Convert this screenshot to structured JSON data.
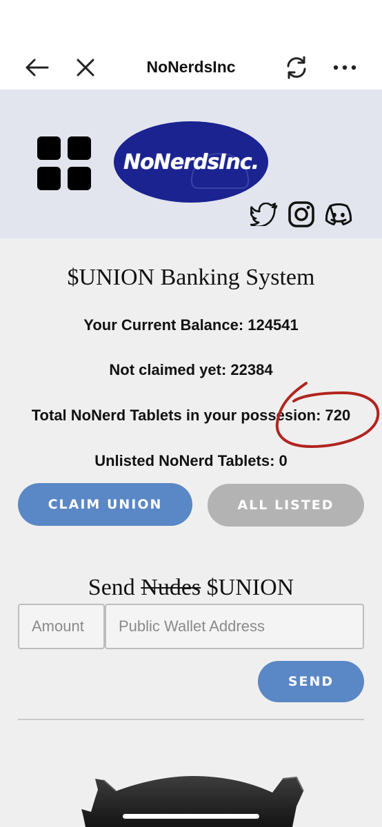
{
  "browser_bar": {
    "title": "NoNerdsInc",
    "icons": [
      "back-arrow-icon",
      "close-icon",
      "refresh-icon",
      "more-icon"
    ]
  },
  "header": {
    "logo_text": "NoNerdsInc.",
    "social_icons": [
      "twitter-icon",
      "instagram-icon",
      "discord-icon"
    ],
    "banner_color": "#e2e5ee",
    "logo_color": "#1a2390"
  },
  "banking": {
    "title": "$UNION Banking System",
    "current_balance": "Your Current Balance: 124541",
    "not_claimed": "Not claimed yet: 22384",
    "total_tablets": "Total NoNerd Tablets in your possesion: 720",
    "unlisted_tablets": "Unlisted NoNerd Tablets: 0",
    "claim_button": "CLAIM UNION",
    "all_listed_button": "ALL LISTED"
  },
  "send": {
    "title_prefix": "Send",
    "title_struck": "Nudes",
    "title_suffix": "$UNION",
    "amount_placeholder": "Amount",
    "wallet_placeholder": "Public Wallet Address",
    "send_button": "SEND"
  },
  "colors": {
    "button_blue": "#5a87c5",
    "button_grey": "#b3b3b3",
    "annotation_red": "#b1241e"
  }
}
